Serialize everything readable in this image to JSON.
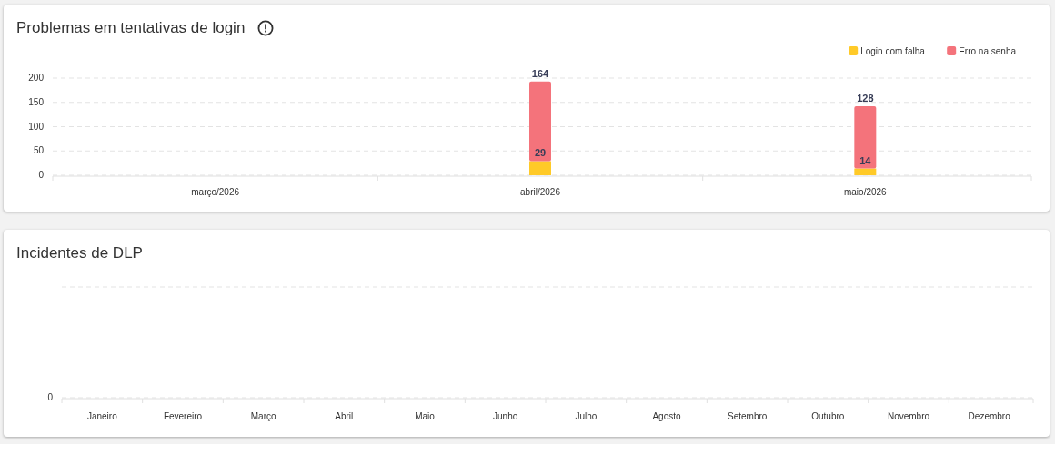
{
  "cards": [
    {
      "title": "Problemas em tentativas de login",
      "info_icon": true,
      "chart_data": {
        "type": "bar",
        "stacked": true,
        "data_labels": true,
        "grid": true,
        "legend": true,
        "categories": [
          "março/2026",
          "abril/2026",
          "maio/2026"
        ],
        "ylim": [
          0,
          200
        ],
        "yticks": [
          0,
          50,
          100,
          150,
          200
        ],
        "series": [
          {
            "name": "Login com falha",
            "color": "#ffca28",
            "values": [
              null,
              29,
              14
            ]
          },
          {
            "name": "Erro na senha",
            "color": "#f4737b",
            "values": [
              null,
              164,
              128
            ]
          }
        ]
      }
    },
    {
      "title": "Incidentes de DLP",
      "info_icon": false,
      "chart_data": {
        "type": "other",
        "categories": [
          "Janeiro",
          "Fevereiro",
          "Março",
          "Abril",
          "Maio",
          "Junho",
          "Julho",
          "Agosto",
          "Setembro",
          "Outubro",
          "Novembro",
          "Dezembro"
        ],
        "annotations": [
          {
            "text": "0"
          }
        ]
      }
    }
  ]
}
